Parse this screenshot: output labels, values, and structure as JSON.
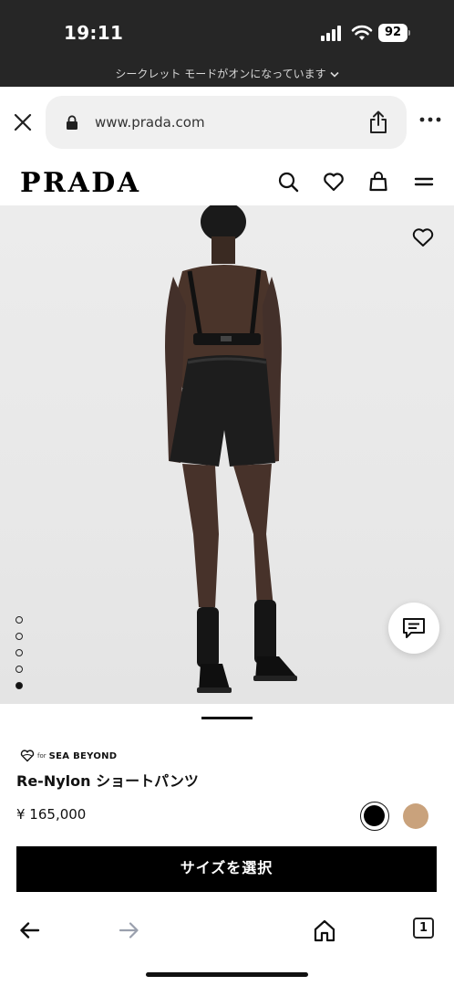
{
  "status_bar": {
    "time": "19:11",
    "battery": "92",
    "incognito_notice": "シークレット モードがオンになっています",
    "icons": [
      "signal-icon",
      "wifi-icon",
      "battery-icon",
      "chevron-down-icon"
    ]
  },
  "browser": {
    "url": "www.prada.com",
    "icons": [
      "close-icon",
      "lock-icon",
      "share-icon",
      "more-icon"
    ]
  },
  "site_header": {
    "logo": "PRADA",
    "icons": [
      "search-icon",
      "wishlist-icon",
      "bag-icon",
      "menu-icon"
    ]
  },
  "gallery": {
    "image_count": 5,
    "active_index": 5,
    "icons": [
      "heart-icon",
      "chat-icon"
    ]
  },
  "product": {
    "badge_for": "for",
    "badge_brand": "SEA BEYOND",
    "name": "Re-Nylon ショートパンツ",
    "price": "¥ 165,000",
    "colors": [
      "#000000",
      "#c9a27c"
    ],
    "selected_color": "#000000",
    "cta_label": "サイズを選択"
  },
  "toolbar": {
    "tabs_count": "1",
    "icons": [
      "back-arrow-icon",
      "forward-arrow-icon",
      "home-icon",
      "tabs-icon"
    ]
  }
}
